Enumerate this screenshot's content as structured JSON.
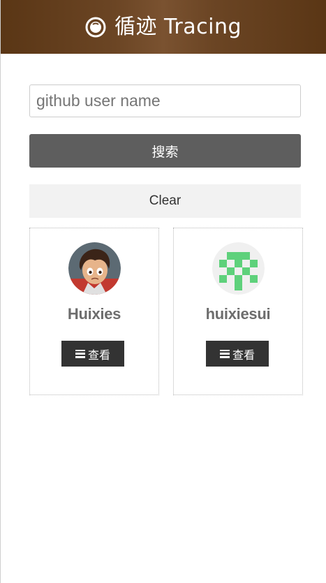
{
  "header": {
    "title": "循迹 Tracing",
    "icon": "target-ring-icon",
    "colors": {
      "background": "#5a3615",
      "text": "#ffffff"
    }
  },
  "search": {
    "placeholder": "github user name",
    "value": "",
    "button_label": "搜索"
  },
  "clear": {
    "label": "Clear"
  },
  "results": [
    {
      "username": "Huixies",
      "avatar": "cartoon-boy-avatar",
      "view_label": "查看",
      "view_icon": "menu-icon"
    },
    {
      "username": "huixiesui",
      "avatar": "green-identicon-avatar",
      "view_label": "查看",
      "view_icon": "menu-icon"
    }
  ]
}
